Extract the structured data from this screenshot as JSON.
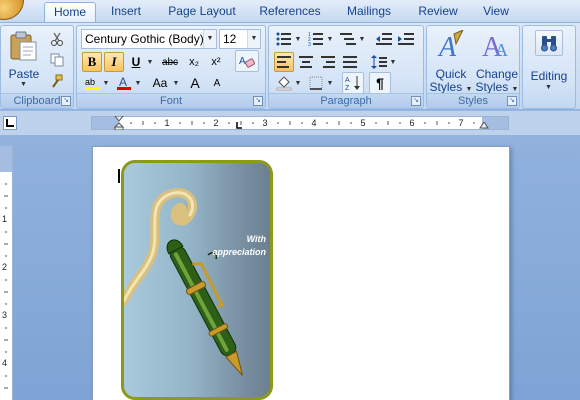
{
  "tabs": [
    "Home",
    "Insert",
    "Page Layout",
    "References",
    "Mailings",
    "Review",
    "View"
  ],
  "active_tab": "Home",
  "clipboard": {
    "paste_label": "Paste",
    "group_label": "Clipboard",
    "cut_icon": "scissors-icon",
    "copy_icon": "copy-icon",
    "format_painter_icon": "brush-icon"
  },
  "font": {
    "font_name": "Century Gothic (Body)",
    "font_size": "12",
    "group_label": "Font",
    "bold": "B",
    "italic": "I",
    "underline": "U",
    "strike": "abc",
    "subscript": "x₂",
    "superscript": "x²",
    "case": "Aa",
    "grow": "A",
    "shrink": "A",
    "highlight_color": "#ffff00",
    "font_color": "#e00000"
  },
  "paragraph": {
    "group_label": "Paragraph",
    "sort": "A Z",
    "pilcrow": "¶"
  },
  "styles": {
    "group_label": "Styles",
    "quick_styles_line1": "Quick",
    "quick_styles_line2": "Styles",
    "change_styles_line1": "Change",
    "change_styles_line2": "Styles"
  },
  "editing": {
    "label": "Editing"
  },
  "ruler": {
    "h_numbers": [
      "1",
      "2",
      "3",
      "4",
      "5",
      "6",
      "7"
    ],
    "v_numbers": [
      "1",
      "2",
      "3",
      "4"
    ]
  },
  "card": {
    "line1": "With",
    "line2": "appreciation"
  },
  "colors": {
    "accent": "#15428b",
    "ribbon": "#c4d8f0",
    "pressed": "#f9c25e",
    "card_border": "#8c9a1c"
  }
}
